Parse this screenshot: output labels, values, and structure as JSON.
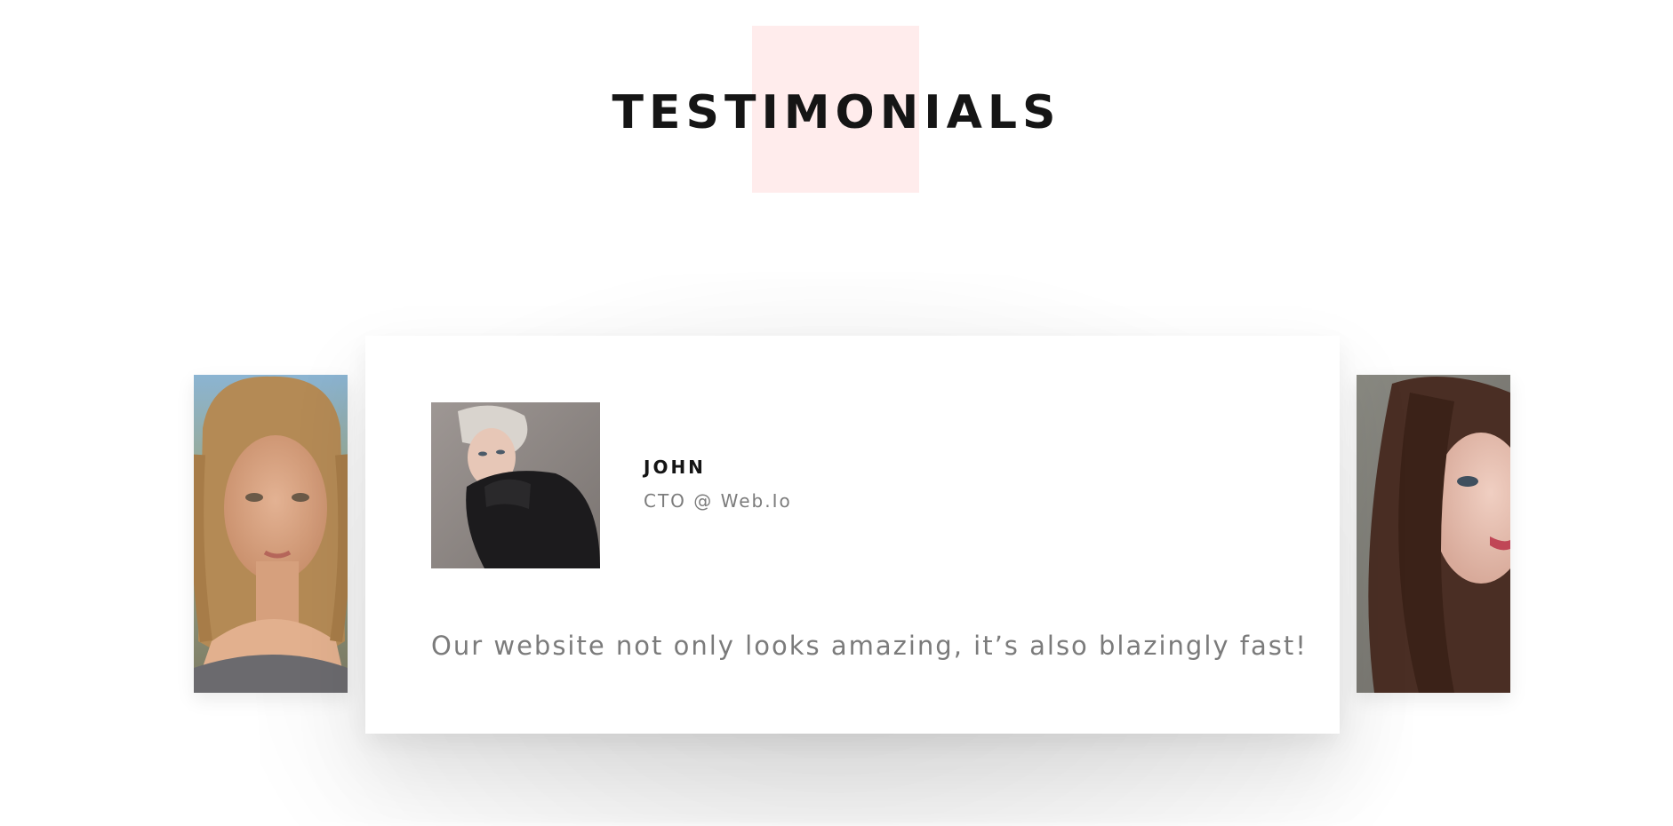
{
  "section": {
    "title": "TESTIMONIALS"
  },
  "testimonial": {
    "name": "JOHN",
    "role": "CTO @ Web.Io",
    "quote": "Our website not only looks amazing, it’s also blazingly fast!"
  },
  "colors": {
    "accent_square": "#ffecec",
    "title_text": "#151515",
    "muted_text": "#7b7b7b",
    "card_background": "#ffffff"
  }
}
